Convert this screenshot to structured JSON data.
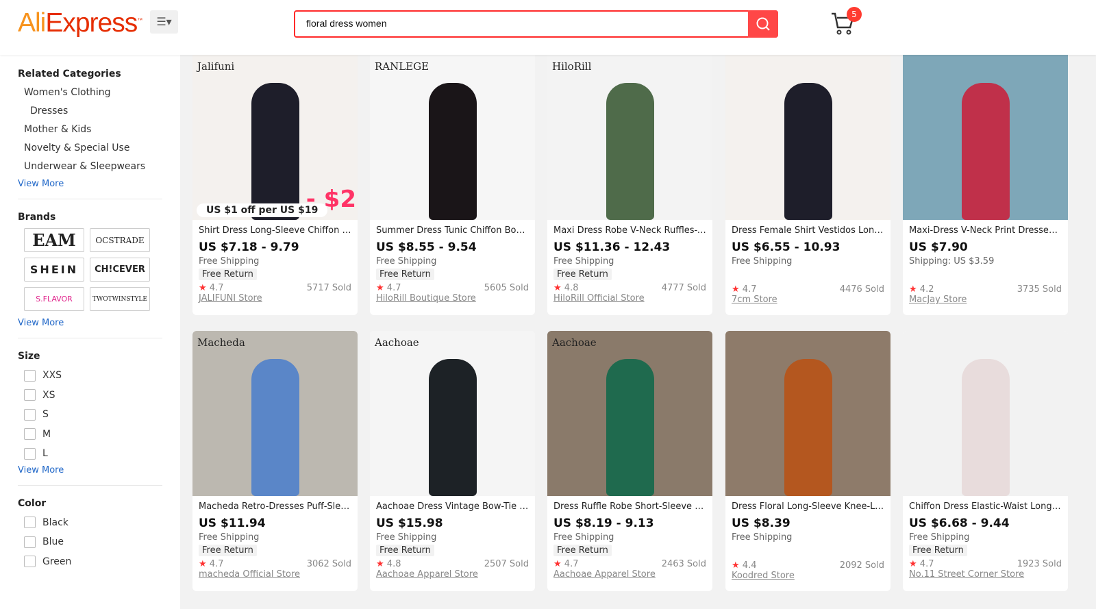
{
  "header": {
    "logo": "AliExpress",
    "search_value": "floral dress women",
    "cart_count": "5"
  },
  "sidebar": {
    "related_title": "Related Categories",
    "categories": [
      "Women's Clothing",
      "Dresses",
      "Mother & Kids",
      "Novelty & Special Use",
      "Underwear & Sleepwears"
    ],
    "view_more": "View More",
    "brands_title": "Brands",
    "brands": [
      "EAM",
      "OCSTRADE",
      "SHEIN",
      "CH!CEVER",
      "S.FLAVOR",
      "TWOTWINSTYLE"
    ],
    "size_title": "Size",
    "sizes": [
      "XXS",
      "XS",
      "S",
      "M",
      "L"
    ],
    "color_title": "Color",
    "colors": [
      "Black",
      "Blue",
      "Green"
    ]
  },
  "products": [
    {
      "title": "Shirt Dress Long-Sleeve Chiffon Pri...",
      "price": "US $7.18 - 9.79",
      "shipping": "Free Shipping",
      "free_return": "Free Return",
      "rating": "4.7",
      "sold": "5717 Sold",
      "store": "JALIFUNI Store",
      "img_logo": "Jalifuni",
      "promo": "US $1 off per US $19",
      "promo_big": "- $2",
      "color": "#1e1e2a",
      "bg": "#f4f1ee"
    },
    {
      "title": "Summer Dress Tunic Chiffon Boho...",
      "price": "US $8.55 - 9.54",
      "shipping": "Free Shipping",
      "free_return": "Free Return",
      "rating": "4.7",
      "sold": "5605 Sold",
      "store": "HiloRill Boutique Store",
      "img_logo": "RANLEGE",
      "color": "#1a1518",
      "bg": "#f6f6f6"
    },
    {
      "title": "Maxi Dress Robe V-Neck Ruffles-W...",
      "price": "US $11.36 - 12.43",
      "shipping": "Free Shipping",
      "free_return": "Free Return",
      "rating": "4.8",
      "sold": "4777 Sold",
      "store": "HiloRill Official Store",
      "img_logo": "HiloRill",
      "color": "#4f6b4a",
      "bg": "#f3f3f3"
    },
    {
      "title": "Dress Female Shirt Vestidos Long-...",
      "price": "US $6.55 - 10.93",
      "shipping": "Free Shipping",
      "free_return": "",
      "rating": "4.7",
      "sold": "4476 Sold",
      "store": "7cm Store",
      "img_logo": "",
      "color": "#1e1e2a",
      "bg": "#f4f1ee"
    },
    {
      "title": "Maxi-Dress V-Neck Print Dresses-A...",
      "price": "US $7.90",
      "shipping": "Shipping: US $3.59",
      "free_return": "",
      "rating": "4.2",
      "sold": "3735 Sold",
      "store": "MacJay Store",
      "img_logo": "",
      "color": "#c0304a",
      "bg": "#7ea7b8"
    },
    {
      "title": "Macheda Retro-Dresses Puff-Sleev...",
      "price": "US $11.94",
      "shipping": "Free Shipping",
      "free_return": "Free Return",
      "rating": "4.7",
      "sold": "3062 Sold",
      "store": "macheda Official Store",
      "img_logo": "Macheda",
      "color": "#5a86c8",
      "bg": "#bcb8b0"
    },
    {
      "title": "Aachoae Dress Vintage Bow-Tie Ve...",
      "price": "US $15.98",
      "shipping": "Free Shipping",
      "free_return": "Free Return",
      "rating": "4.8",
      "sold": "2507 Sold",
      "store": "Aachoae Apparel Store",
      "img_logo": "Aachoae",
      "color": "#1d2226",
      "bg": "#f5f5f5"
    },
    {
      "title": "Dress Ruffle Robe Short-Sleeve A-L...",
      "price": "US $8.19 - 9.13",
      "shipping": "Free Shipping",
      "free_return": "Free Return",
      "rating": "4.7",
      "sold": "2463 Sold",
      "store": "Aachoae Apparel Store",
      "img_logo": "Aachoae",
      "color": "#1f6a4e",
      "bg": "#8a7a6a"
    },
    {
      "title": "Dress Floral Long-Sleeve Knee-Len...",
      "price": "US $8.39",
      "shipping": "Free Shipping",
      "free_return": "",
      "rating": "4.4",
      "sold": "2092 Sold",
      "store": "Koodred Store",
      "img_logo": "",
      "color": "#b4571f",
      "bg": "#8e7b6a"
    },
    {
      "title": "Chiffon Dress Elastic-Waist Long-Sl...",
      "price": "US $6.68 - 9.44",
      "shipping": "Free Shipping",
      "free_return": "Free Return",
      "rating": "4.7",
      "sold": "1923 Sold",
      "store": "No.11 Street Corner Store",
      "img_logo": "",
      "color": "#e8dcdc",
      "bg": "#f2f2f2"
    }
  ]
}
